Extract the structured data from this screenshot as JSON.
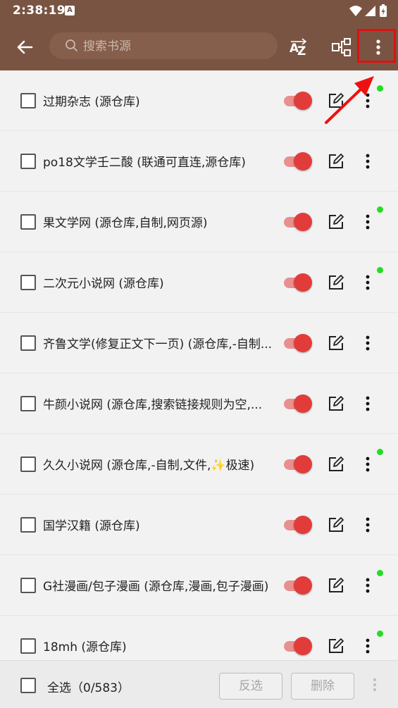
{
  "status": {
    "time": "2:38:19",
    "app_icon": "A"
  },
  "toolbar": {
    "search_placeholder": "搜索书源",
    "sort_icon": "sort-az-icon",
    "group_icon": "group-icon",
    "overflow_icon": "more-vert-icon"
  },
  "sources": [
    {
      "label": "过期杂志 (源仓库)",
      "enabled": true,
      "dot": true
    },
    {
      "label": "po18文学壬二酸 (联通可直连,源仓库)",
      "enabled": true,
      "dot": false
    },
    {
      "label": "果文学网 (源仓库,自制,网页源)",
      "enabled": true,
      "dot": true
    },
    {
      "label": "二次元小说网 (源仓库)",
      "enabled": true,
      "dot": true
    },
    {
      "label": "齐鲁文学(修复正文下一页) (源仓库,-自制...",
      "enabled": true,
      "dot": false
    },
    {
      "label": "牛颜小说网 (源仓库,搜索链接规则为空,...",
      "enabled": true,
      "dot": false
    },
    {
      "label": "久久小说网 (源仓库,-自制,文件,✨极速)",
      "enabled": true,
      "dot": true
    },
    {
      "label": "国学汉籍 (源仓库)",
      "enabled": true,
      "dot": false
    },
    {
      "label": "G社漫画/包子漫画 (源仓库,漫画,包子漫画)",
      "enabled": true,
      "dot": true
    },
    {
      "label": "18mh (源仓库)",
      "enabled": true,
      "dot": true
    }
  ],
  "bottom": {
    "select_all_label": "全选（0/583）",
    "invert_label": "反选",
    "delete_label": "删除"
  },
  "colors": {
    "primary": "#7a5442",
    "switch_on": "#e23c3a",
    "online_dot": "#22dd22",
    "highlight": "#e01010"
  }
}
